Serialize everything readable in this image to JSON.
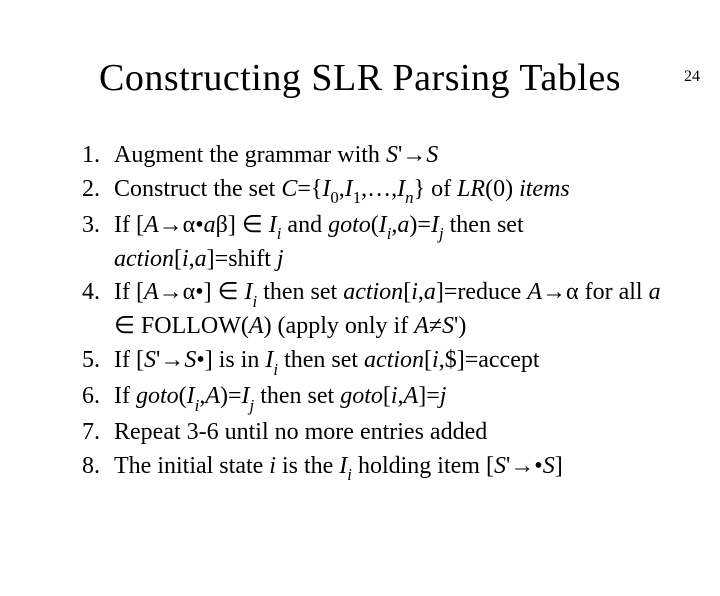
{
  "page_number": "24",
  "title": "Constructing SLR Parsing Tables",
  "items": [
    {
      "num": "1.",
      "html": "Augment the grammar with <span class='i'>S</span>'→<span class='i'>S</span>"
    },
    {
      "num": "2.",
      "html": "Construct the set <span class='i'>C</span>={<span class='i'>I</span><span class='sub'>0</span>,<span class='i'>I</span><span class='sub'>1</span>,…,<span class='i'>I</span><span class='sub i'>n</span>} of <span class='i'>LR</span>(0) <span class='i'>items</span>"
    },
    {
      "num": "3.",
      "html": "If [<span class='i'>A</span>→α•<span class='i'>a</span>β] ∈ <span class='i'>I<span class='sub'>i</span></span> and <span class='i'>goto</span>(<span class='i'>I<span class='sub'>i</span></span>,<span class='i'>a</span>)=<span class='i'>I<span class='sub'>j</span></span> then set <span class='i'>action</span>[<span class='i'>i</span>,<span class='i'>a</span>]=shift <span class='i'>j</span>"
    },
    {
      "num": "4.",
      "html": "If [<span class='i'>A</span>→α•] ∈ <span class='i'>I<span class='sub'>i</span></span> then set <span class='i'>action</span>[<span class='i'>i</span>,<span class='i'>a</span>]=reduce <span class='i'>A</span>→α for all <span class='i'>a</span> ∈ FOLLOW(<span class='i'>A</span>) (apply only if <span class='i'>A</span>≠<span class='i'>S</span>')"
    },
    {
      "num": "5.",
      "html": "If [<span class='i'>S</span>'→<span class='i'>S</span>•] is in <span class='i'>I<span class='sub'>i</span></span> then set <span class='i'>action</span>[<span class='i'>i</span>,$]=accept"
    },
    {
      "num": "6.",
      "html": "If <span class='i'>goto</span>(<span class='i'>I<span class='sub'>i</span></span>,<span class='i'>A</span>)=<span class='i'>I<span class='sub'>j</span></span> then set <span class='i'>goto</span>[<span class='i'>i</span>,<span class='i'>A</span>]=<span class='i'>j</span>"
    },
    {
      "num": "7.",
      "html": "Repeat 3-6 until no more entries added"
    },
    {
      "num": "8.",
      "html": "The initial state <span class='i'>i</span> is the <span class='i'>I<span class='sub'>i</span></span> holding item [<span class='i'>S</span>'→•<span class='i'>S</span>]"
    }
  ]
}
